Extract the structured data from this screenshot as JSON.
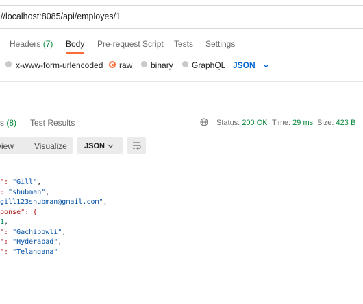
{
  "url_bar": {
    "value": "//localhost:8085/api/employes/1"
  },
  "request_tabs": [
    {
      "label": "Headers",
      "count": "(7)"
    },
    {
      "label": "Body"
    },
    {
      "label": "Pre-request Script"
    },
    {
      "label": "Tests"
    },
    {
      "label": "Settings"
    }
  ],
  "body_options": [
    {
      "label": "x-www-form-urlencoded"
    },
    {
      "label": "raw"
    },
    {
      "label": "binary"
    },
    {
      "label": "GraphQL"
    }
  ],
  "body_format": "JSON",
  "response_tabs": [
    {
      "label": "rs",
      "count": "(8)"
    },
    {
      "label": "Test Results"
    }
  ],
  "status": {
    "label": "Status:",
    "value": "200 OK",
    "time_label": "Time:",
    "time_value": "29 ms",
    "size_label": "Size:",
    "size_value": "423 B"
  },
  "view_modes": [
    "view",
    "Visualize"
  ],
  "response_format": "JSON",
  "code_lines": [
    [
      "\": ",
      "\"Gill\"",
      ","
    ],
    [
      ": ",
      "\"shubman\"",
      ","
    ],
    [
      "gill123shubman@gmail.com\"",
      ","
    ],
    [
      "ponse\": {"
    ],
    [
      "1",
      ","
    ],
    [
      "\": ",
      "\"Gachibowli\"",
      ","
    ],
    [
      "\": ",
      "\"Hyderabad\"",
      ","
    ],
    [
      "\": ",
      "\"Telangana\""
    ]
  ],
  "colors": {
    "accent": "#ff6c37",
    "link_blue": "#0265d2",
    "status_green": "#0b8a3c"
  }
}
